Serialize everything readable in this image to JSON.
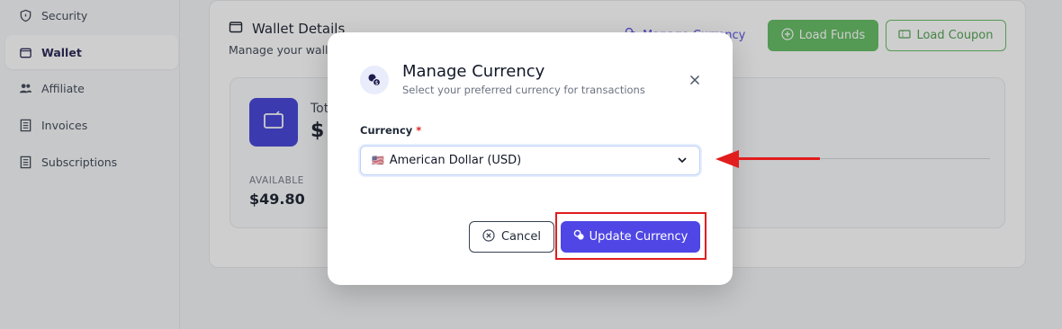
{
  "sidebar": {
    "items": [
      {
        "label": "Security",
        "icon": "shield-icon"
      },
      {
        "label": "Wallet",
        "icon": "wallet-icon",
        "active": true
      },
      {
        "label": "Affiliate",
        "icon": "users-icon"
      },
      {
        "label": "Invoices",
        "icon": "invoice-icon"
      },
      {
        "label": "Subscriptions",
        "icon": "subscriptions-icon"
      }
    ]
  },
  "wallet": {
    "title": "Wallet Details",
    "subtitle": "Manage your walle",
    "manage_currency_label": "Manage Currency",
    "load_funds_label": "Load Funds",
    "load_coupon_label": "Load Coupon",
    "total_label": "Tot",
    "total_value": "$",
    "available_label": "AVAILABLE",
    "available_value": "$49.80"
  },
  "modal": {
    "title": "Manage Currency",
    "subtitle": "Select your preferred currency for transactions",
    "field_label": "Currency",
    "required_mark": "*",
    "selected_flag": "🇺🇸",
    "selected_value": "American Dollar (USD)",
    "cancel_label": "Cancel",
    "update_label": "Update Currency"
  },
  "colors": {
    "accent": "#4f46e5",
    "green": "#5cb85c",
    "annotation_red": "#e11d1d"
  }
}
